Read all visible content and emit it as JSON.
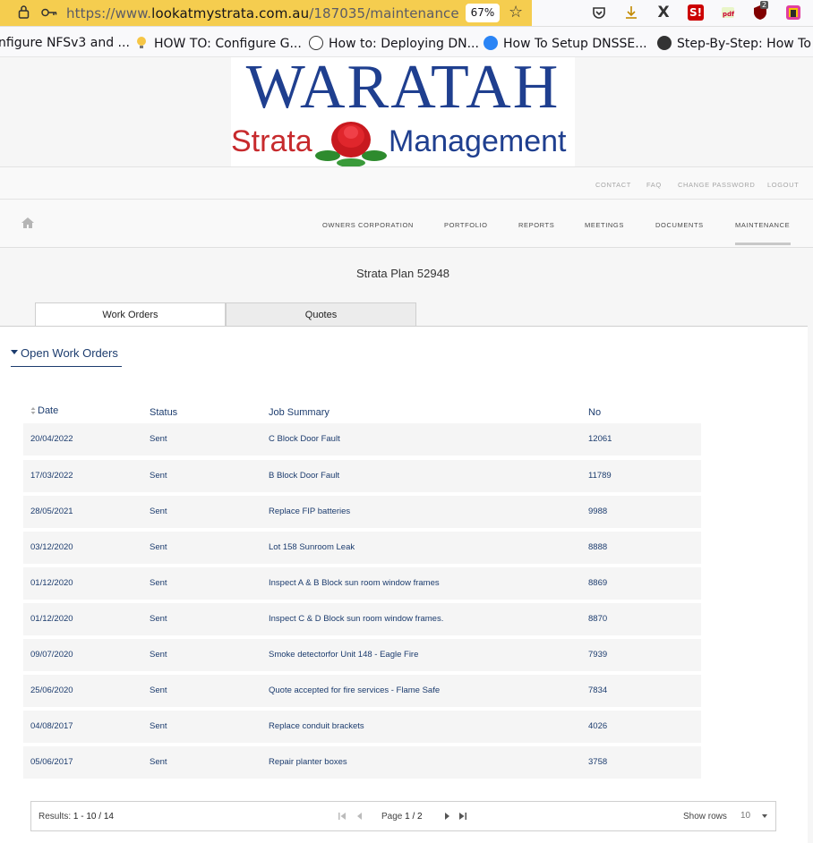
{
  "browser": {
    "url_prefix": "https://www.",
    "url_host": "lookatmystrata.com.au",
    "url_path": "/187035/maintenance",
    "zoom": "67%",
    "ext_badge": "2",
    "bookmarks": [
      {
        "label": "nfigure NFSv3 and ..."
      },
      {
        "label": "HOW TO: Configure G..."
      },
      {
        "label": "How to: Deploying DN..."
      },
      {
        "label": "How To Setup DNSSE..."
      },
      {
        "label": "Step-By-Step: How To ..."
      }
    ]
  },
  "logo": {
    "line1": "WARATAH",
    "strata": "Strata",
    "management": "Management"
  },
  "topnav": {
    "contact": "CONTACT",
    "faq": "FAQ",
    "change_password": "CHANGE PASSWORD",
    "logout": "LOGOUT"
  },
  "mainnav": {
    "owners": "OWNERS CORPORATION",
    "portfolio": "PORTFOLIO",
    "reports": "REPORTS",
    "meetings": "MEETINGS",
    "documents": "DOCUMENTS",
    "maintenance": "MAINTENANCE"
  },
  "plan_title": "Strata Plan 52948",
  "tabs": {
    "work_orders": "Work Orders",
    "quotes": "Quotes"
  },
  "section": {
    "title": "Open Work Orders"
  },
  "table": {
    "headers": {
      "date": "Date",
      "status": "Status",
      "job": "Job Summary",
      "no": "No"
    },
    "rows": [
      {
        "date": "20/04/2022",
        "status": "Sent",
        "job": "C Block Door Fault",
        "no": "12061"
      },
      {
        "date": "17/03/2022",
        "status": "Sent",
        "job": "B Block Door Fault",
        "no": "11789"
      },
      {
        "date": "28/05/2021",
        "status": "Sent",
        "job": "Replace FIP batteries",
        "no": "9988"
      },
      {
        "date": "03/12/2020",
        "status": "Sent",
        "job": "Lot 158 Sunroom Leak",
        "no": "8888"
      },
      {
        "date": "01/12/2020",
        "status": "Sent",
        "job": "Inspect A & B Block sun room window frames",
        "no": "8869"
      },
      {
        "date": "01/12/2020",
        "status": "Sent",
        "job": "Inspect C & D Block sun room window frames.",
        "no": "8870"
      },
      {
        "date": "09/07/2020",
        "status": "Sent",
        "job": "Smoke detectorfor Unit 148 - Eagle Fire",
        "no": "7939"
      },
      {
        "date": "25/06/2020",
        "status": "Sent",
        "job": "Quote accepted for fire services - Flame Safe",
        "no": "7834"
      },
      {
        "date": "04/08/2017",
        "status": "Sent",
        "job": "Replace conduit brackets",
        "no": "4026"
      },
      {
        "date": "05/06/2017",
        "status": "Sent",
        "job": "Repair planter boxes",
        "no": "3758"
      }
    ]
  },
  "pager": {
    "results_label": "Results:",
    "results_range": "1 - 10 / 14",
    "page_label": "Page",
    "page_value": "1 / 2",
    "show_rows": "Show rows",
    "rows_value": "10"
  }
}
